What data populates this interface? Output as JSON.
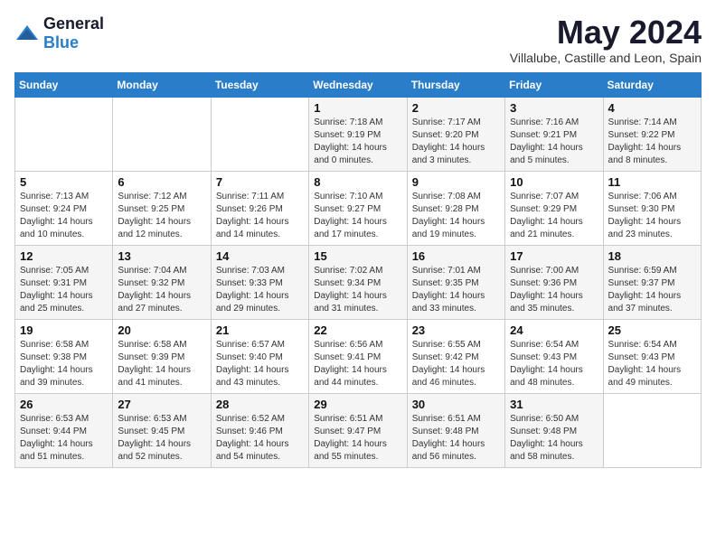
{
  "logo": {
    "general": "General",
    "blue": "Blue"
  },
  "title": "May 2024",
  "subtitle": "Villalube, Castille and Leon, Spain",
  "weekdays": [
    "Sunday",
    "Monday",
    "Tuesday",
    "Wednesday",
    "Thursday",
    "Friday",
    "Saturday"
  ],
  "weeks": [
    [
      {
        "day": "",
        "sunrise": "",
        "sunset": "",
        "daylight": ""
      },
      {
        "day": "",
        "sunrise": "",
        "sunset": "",
        "daylight": ""
      },
      {
        "day": "",
        "sunrise": "",
        "sunset": "",
        "daylight": ""
      },
      {
        "day": "1",
        "sunrise": "Sunrise: 7:18 AM",
        "sunset": "Sunset: 9:19 PM",
        "daylight": "Daylight: 14 hours and 0 minutes."
      },
      {
        "day": "2",
        "sunrise": "Sunrise: 7:17 AM",
        "sunset": "Sunset: 9:20 PM",
        "daylight": "Daylight: 14 hours and 3 minutes."
      },
      {
        "day": "3",
        "sunrise": "Sunrise: 7:16 AM",
        "sunset": "Sunset: 9:21 PM",
        "daylight": "Daylight: 14 hours and 5 minutes."
      },
      {
        "day": "4",
        "sunrise": "Sunrise: 7:14 AM",
        "sunset": "Sunset: 9:22 PM",
        "daylight": "Daylight: 14 hours and 8 minutes."
      }
    ],
    [
      {
        "day": "5",
        "sunrise": "Sunrise: 7:13 AM",
        "sunset": "Sunset: 9:24 PM",
        "daylight": "Daylight: 14 hours and 10 minutes."
      },
      {
        "day": "6",
        "sunrise": "Sunrise: 7:12 AM",
        "sunset": "Sunset: 9:25 PM",
        "daylight": "Daylight: 14 hours and 12 minutes."
      },
      {
        "day": "7",
        "sunrise": "Sunrise: 7:11 AM",
        "sunset": "Sunset: 9:26 PM",
        "daylight": "Daylight: 14 hours and 14 minutes."
      },
      {
        "day": "8",
        "sunrise": "Sunrise: 7:10 AM",
        "sunset": "Sunset: 9:27 PM",
        "daylight": "Daylight: 14 hours and 17 minutes."
      },
      {
        "day": "9",
        "sunrise": "Sunrise: 7:08 AM",
        "sunset": "Sunset: 9:28 PM",
        "daylight": "Daylight: 14 hours and 19 minutes."
      },
      {
        "day": "10",
        "sunrise": "Sunrise: 7:07 AM",
        "sunset": "Sunset: 9:29 PM",
        "daylight": "Daylight: 14 hours and 21 minutes."
      },
      {
        "day": "11",
        "sunrise": "Sunrise: 7:06 AM",
        "sunset": "Sunset: 9:30 PM",
        "daylight": "Daylight: 14 hours and 23 minutes."
      }
    ],
    [
      {
        "day": "12",
        "sunrise": "Sunrise: 7:05 AM",
        "sunset": "Sunset: 9:31 PM",
        "daylight": "Daylight: 14 hours and 25 minutes."
      },
      {
        "day": "13",
        "sunrise": "Sunrise: 7:04 AM",
        "sunset": "Sunset: 9:32 PM",
        "daylight": "Daylight: 14 hours and 27 minutes."
      },
      {
        "day": "14",
        "sunrise": "Sunrise: 7:03 AM",
        "sunset": "Sunset: 9:33 PM",
        "daylight": "Daylight: 14 hours and 29 minutes."
      },
      {
        "day": "15",
        "sunrise": "Sunrise: 7:02 AM",
        "sunset": "Sunset: 9:34 PM",
        "daylight": "Daylight: 14 hours and 31 minutes."
      },
      {
        "day": "16",
        "sunrise": "Sunrise: 7:01 AM",
        "sunset": "Sunset: 9:35 PM",
        "daylight": "Daylight: 14 hours and 33 minutes."
      },
      {
        "day": "17",
        "sunrise": "Sunrise: 7:00 AM",
        "sunset": "Sunset: 9:36 PM",
        "daylight": "Daylight: 14 hours and 35 minutes."
      },
      {
        "day": "18",
        "sunrise": "Sunrise: 6:59 AM",
        "sunset": "Sunset: 9:37 PM",
        "daylight": "Daylight: 14 hours and 37 minutes."
      }
    ],
    [
      {
        "day": "19",
        "sunrise": "Sunrise: 6:58 AM",
        "sunset": "Sunset: 9:38 PM",
        "daylight": "Daylight: 14 hours and 39 minutes."
      },
      {
        "day": "20",
        "sunrise": "Sunrise: 6:58 AM",
        "sunset": "Sunset: 9:39 PM",
        "daylight": "Daylight: 14 hours and 41 minutes."
      },
      {
        "day": "21",
        "sunrise": "Sunrise: 6:57 AM",
        "sunset": "Sunset: 9:40 PM",
        "daylight": "Daylight: 14 hours and 43 minutes."
      },
      {
        "day": "22",
        "sunrise": "Sunrise: 6:56 AM",
        "sunset": "Sunset: 9:41 PM",
        "daylight": "Daylight: 14 hours and 44 minutes."
      },
      {
        "day": "23",
        "sunrise": "Sunrise: 6:55 AM",
        "sunset": "Sunset: 9:42 PM",
        "daylight": "Daylight: 14 hours and 46 minutes."
      },
      {
        "day": "24",
        "sunrise": "Sunrise: 6:54 AM",
        "sunset": "Sunset: 9:43 PM",
        "daylight": "Daylight: 14 hours and 48 minutes."
      },
      {
        "day": "25",
        "sunrise": "Sunrise: 6:54 AM",
        "sunset": "Sunset: 9:43 PM",
        "daylight": "Daylight: 14 hours and 49 minutes."
      }
    ],
    [
      {
        "day": "26",
        "sunrise": "Sunrise: 6:53 AM",
        "sunset": "Sunset: 9:44 PM",
        "daylight": "Daylight: 14 hours and 51 minutes."
      },
      {
        "day": "27",
        "sunrise": "Sunrise: 6:53 AM",
        "sunset": "Sunset: 9:45 PM",
        "daylight": "Daylight: 14 hours and 52 minutes."
      },
      {
        "day": "28",
        "sunrise": "Sunrise: 6:52 AM",
        "sunset": "Sunset: 9:46 PM",
        "daylight": "Daylight: 14 hours and 54 minutes."
      },
      {
        "day": "29",
        "sunrise": "Sunrise: 6:51 AM",
        "sunset": "Sunset: 9:47 PM",
        "daylight": "Daylight: 14 hours and 55 minutes."
      },
      {
        "day": "30",
        "sunrise": "Sunrise: 6:51 AM",
        "sunset": "Sunset: 9:48 PM",
        "daylight": "Daylight: 14 hours and 56 minutes."
      },
      {
        "day": "31",
        "sunrise": "Sunrise: 6:50 AM",
        "sunset": "Sunset: 9:48 PM",
        "daylight": "Daylight: 14 hours and 58 minutes."
      },
      {
        "day": "",
        "sunrise": "",
        "sunset": "",
        "daylight": ""
      }
    ]
  ]
}
